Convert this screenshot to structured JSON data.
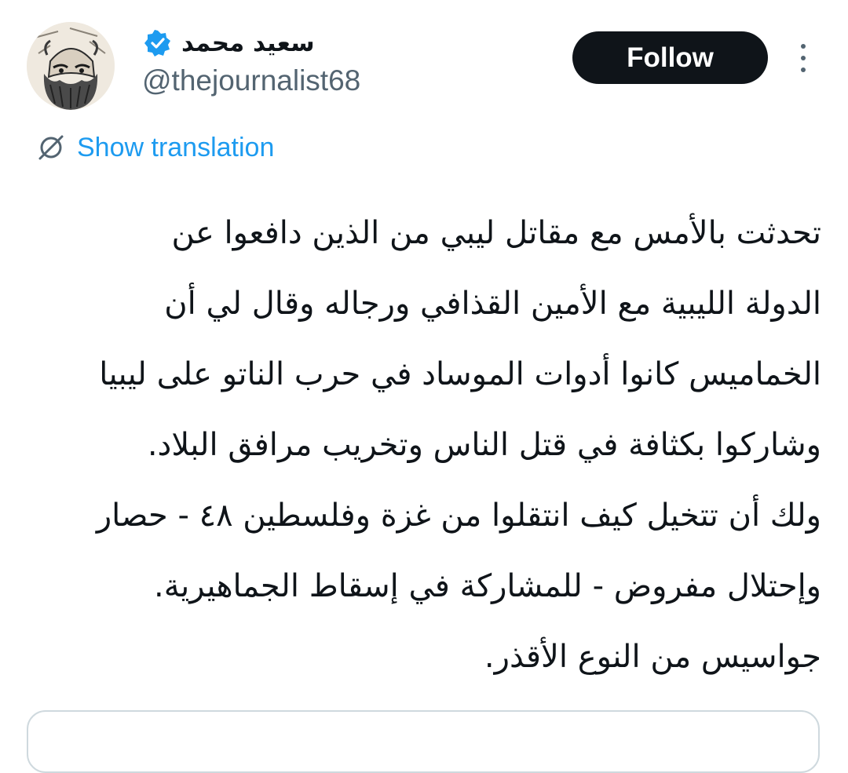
{
  "user": {
    "display_name": "سعيد محمد",
    "handle": "@thejournalist68",
    "verified": true,
    "avatar_icon": "sketched-portrait-avatar"
  },
  "actions": {
    "follow_label": "Follow",
    "more_icon": "more-vertical-icon"
  },
  "translation": {
    "label": "Show translation",
    "icon": "translate-icon"
  },
  "tweet": {
    "lines": [
      "تحدثت بالأمس مع مقاتل ليبي من الذين دافعوا عن",
      "الدولة الليبية مع الأمين القذافي ورجاله وقال لي أن",
      "الخماميس كانوا أدوات الموساد في حرب الناتو على ليبيا",
      "وشاركوا بكثافة في قتل الناس وتخريب مرافق البلاد.",
      "ولك أن تتخيل كيف انتقلوا من غزة وفلسطين ٤٨ - حصار",
      "وإحتلال مفروض - للمشاركة في إسقاط الجماهيرية.",
      "جواسيس من النوع الأقذر."
    ]
  },
  "colors": {
    "text": "#0f1419",
    "muted": "#536471",
    "accent": "#1d9bf0",
    "button_bg": "#0f1419",
    "border": "#cfd9de"
  }
}
